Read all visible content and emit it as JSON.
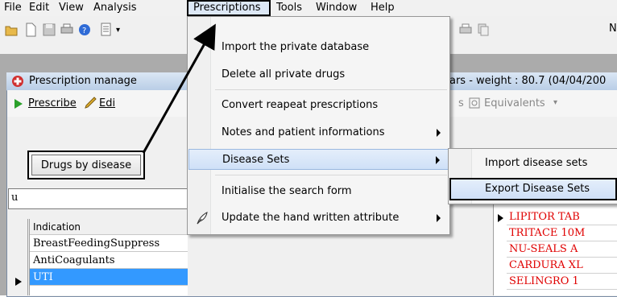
{
  "menubar": {
    "items": [
      "File",
      "Edit",
      "View",
      "Analysis",
      "Prescriptions",
      "Tools",
      "Window",
      "Help"
    ]
  },
  "window": {
    "title_left": "Prescription manage",
    "title_right": "ars - weight : 80.7 (04/04/200"
  },
  "subtoolbar": {
    "prescribe": "Prescribe",
    "edit": "Edi",
    "equivalents_partial": "s",
    "equivalents": "Equivalents"
  },
  "left_panel": {
    "drugs_by_disease": "Drugs by disease",
    "search_value": "u",
    "grid_header": "Indication",
    "rows": [
      "BreastFeedingSuppress",
      "AntiCoagulants",
      "UTI"
    ]
  },
  "right_panel": {
    "rows": [
      "LIPITOR TAB",
      "TRITACE 10M",
      "NU-SEALS A",
      "CARDURA XL",
      "SELINGRO 1"
    ]
  },
  "toolbar": {
    "right_label": "N"
  },
  "prescriptions_menu": {
    "items": [
      {
        "label": "Import the private database",
        "submenu": false
      },
      {
        "label": "Delete all private drugs",
        "submenu": false
      },
      {
        "label": "Convert reapeat prescriptions",
        "submenu": false
      },
      {
        "label": "Notes and patient informations",
        "submenu": true
      },
      {
        "label": "Disease Sets",
        "submenu": true
      },
      {
        "label": "Initialise the search form",
        "submenu": false
      },
      {
        "label": "Update the hand written attribute",
        "submenu": true
      }
    ]
  },
  "disease_sets_submenu": {
    "items": [
      "Import disease sets",
      "Export Disease Sets"
    ]
  },
  "colors": {
    "highlight": "#cfe0f7",
    "selection": "#3399ff",
    "drug_text": "#e00000"
  }
}
